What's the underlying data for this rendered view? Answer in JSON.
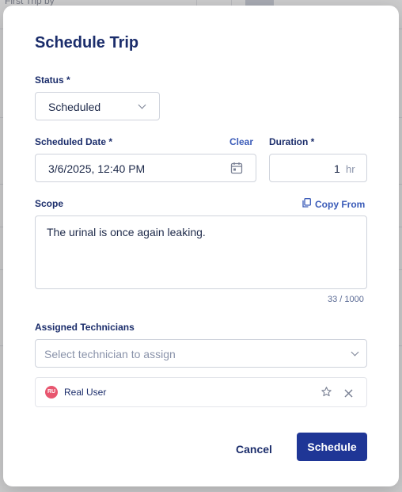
{
  "background": {
    "header_text": "First Trip by"
  },
  "modal": {
    "title": "Schedule Trip",
    "status": {
      "label": "Status *",
      "value": "Scheduled"
    },
    "scheduled_date": {
      "label": "Scheduled Date *",
      "clear_label": "Clear",
      "value": "3/6/2025, 12:40 PM"
    },
    "duration": {
      "label": "Duration *",
      "value": "1",
      "unit": "hr"
    },
    "scope": {
      "label": "Scope",
      "copy_from_label": "Copy From",
      "value": "The urinal is once again leaking.",
      "counter": "33 / 1000"
    },
    "technicians": {
      "label": "Assigned Technicians",
      "placeholder": "Select technician to assign",
      "assigned": [
        {
          "initials": "RU",
          "name": "Real User"
        }
      ]
    },
    "actions": {
      "cancel": "Cancel",
      "schedule": "Schedule"
    }
  },
  "icons": {
    "calendar": "calendar-icon",
    "copy": "copy-icon",
    "star": "star-icon",
    "close": "close-icon",
    "chevron": "chevron-down-icon"
  },
  "colors": {
    "primary": "#1f3696",
    "title": "#1b2d6b",
    "link": "#3a5bb8",
    "avatar": "#e8566f"
  }
}
